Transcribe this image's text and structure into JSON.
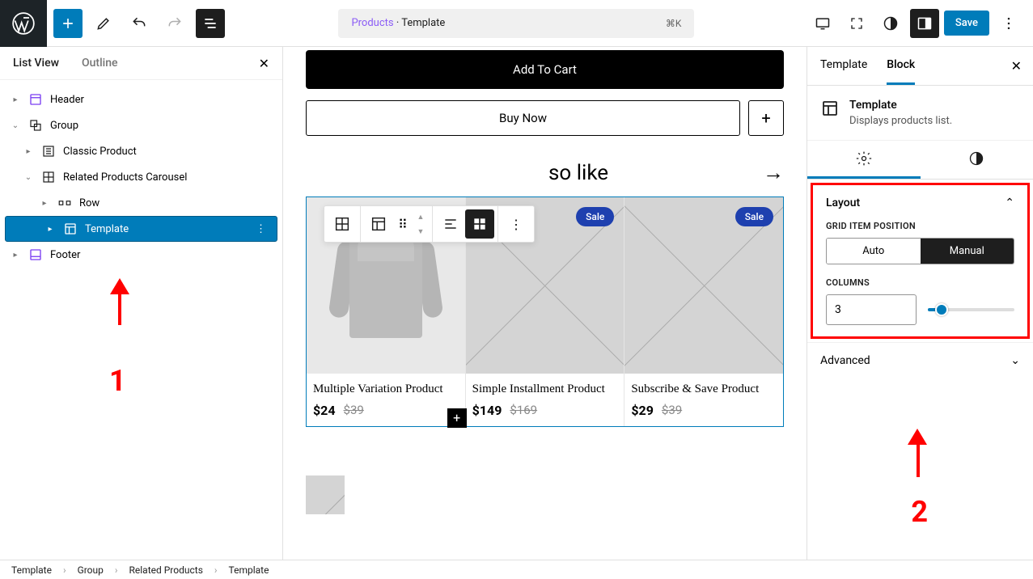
{
  "topbar": {
    "doc_prefix": "Products",
    "doc_suffix": " · Template",
    "shortcut": "⌘K",
    "save": "Save"
  },
  "left": {
    "tab_listview": "List View",
    "tab_outline": "Outline",
    "tree": {
      "header": "Header",
      "group": "Group",
      "classic": "Classic Product",
      "related": "Related Products Carousel",
      "row": "Row",
      "template": "Template",
      "footer": "Footer"
    }
  },
  "annotation": {
    "num1": "1",
    "num2": "2"
  },
  "canvas": {
    "add_cart": "Add To Cart",
    "buy_now": "Buy Now",
    "also_like": "so like",
    "sale": "Sale",
    "products": [
      {
        "name": "Multiple Variation Product",
        "price": "$24",
        "old": "$39"
      },
      {
        "name": "Simple Installment Product",
        "price": "$149",
        "old": "$169"
      },
      {
        "name": "Subscribe & Save Product",
        "price": "$29",
        "old": "$39"
      }
    ]
  },
  "right": {
    "tab_template": "Template",
    "tab_block": "Block",
    "block_name": "Template",
    "block_desc": "Displays products list.",
    "layout": "Layout",
    "grid_pos": "GRID ITEM POSITION",
    "auto": "Auto",
    "manual": "Manual",
    "columns_label": "COLUMNS",
    "columns_value": "3",
    "advanced": "Advanced"
  },
  "breadcrumb": [
    "Template",
    "Group",
    "Related Products",
    "Template"
  ]
}
